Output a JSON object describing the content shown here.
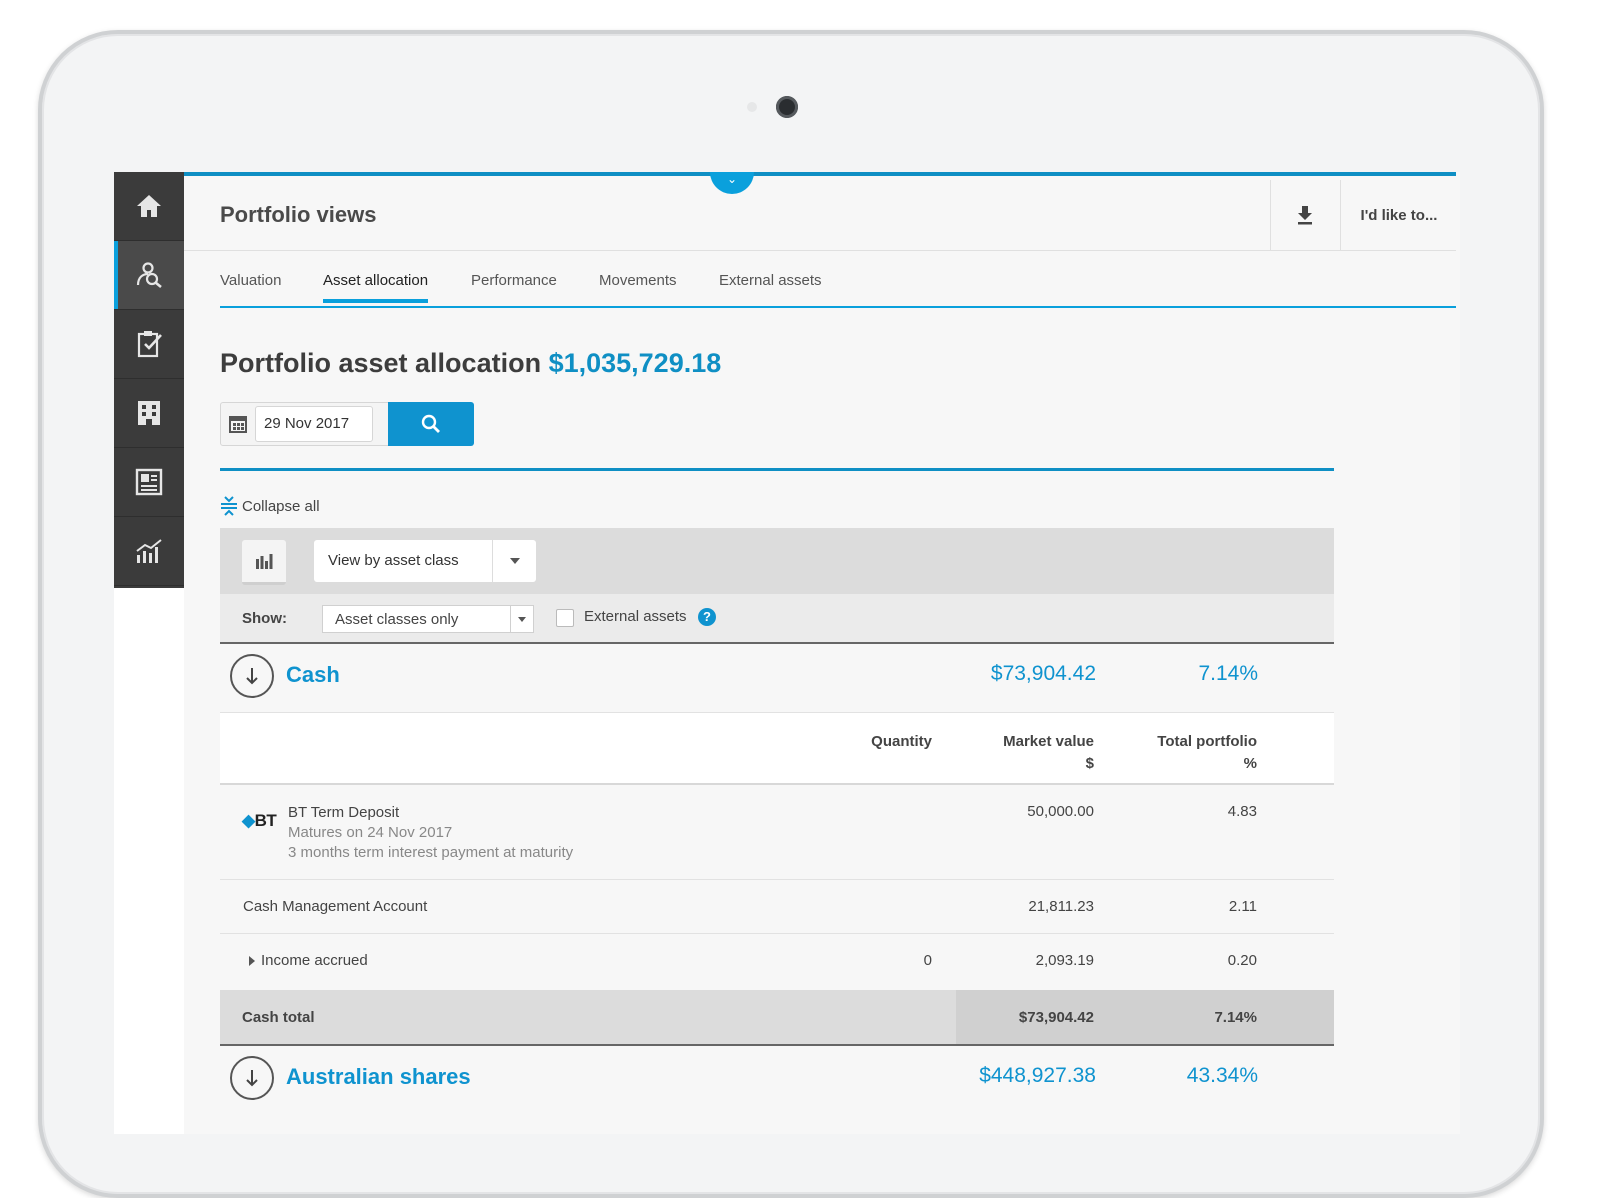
{
  "app": {
    "page_title": "Portfolio views",
    "like_label": "I'd like to..."
  },
  "sidebar": {
    "items": [
      {
        "icon": "home-icon"
      },
      {
        "icon": "portfolio-search-icon",
        "active": true
      },
      {
        "icon": "clipboard-check-icon"
      },
      {
        "icon": "building-icon"
      },
      {
        "icon": "document-icon"
      },
      {
        "icon": "growth-chart-icon"
      }
    ]
  },
  "tabs": [
    {
      "label": "Valuation"
    },
    {
      "label": "Asset allocation",
      "active": true
    },
    {
      "label": "Performance"
    },
    {
      "label": "Movements"
    },
    {
      "label": "External assets"
    }
  ],
  "heading": {
    "title": "Portfolio asset allocation",
    "amount": "$1,035,729.18"
  },
  "date_filter": {
    "value": "29 Nov 2017"
  },
  "collapse_label": "Collapse all",
  "view_select": {
    "value": "View by asset class"
  },
  "show": {
    "label": "Show:",
    "value": "Asset classes only",
    "external_label": "External assets",
    "help": "?"
  },
  "cash": {
    "name": "Cash",
    "value": "$73,904.42",
    "pct": "7.14%"
  },
  "columns": {
    "quantity": "Quantity",
    "market_value": "Market value",
    "market_value_unit": "$",
    "total_portfolio": "Total portfolio",
    "total_portfolio_unit": "%"
  },
  "rows": [
    {
      "logo": "BT",
      "name": "BT Term Deposit",
      "sub1": "Matures on 24 Nov 2017",
      "sub2": "3 months term interest payment at maturity",
      "quantity": "",
      "market_value": "50,000.00",
      "pct": "4.83"
    },
    {
      "name": "Cash Management Account",
      "quantity": "",
      "market_value": "21,811.23",
      "pct": "2.11"
    },
    {
      "name": "Income accrued",
      "quantity": "0",
      "market_value": "2,093.19",
      "pct": "0.20"
    }
  ],
  "cash_total": {
    "label": "Cash total",
    "value": "$73,904.42",
    "pct": "7.14%"
  },
  "aus_shares": {
    "name": "Australian shares",
    "value": "$448,927.38",
    "pct": "43.34%"
  },
  "colors": {
    "accent": "#0f93cf",
    "sidebar": "#3b3b3b"
  }
}
